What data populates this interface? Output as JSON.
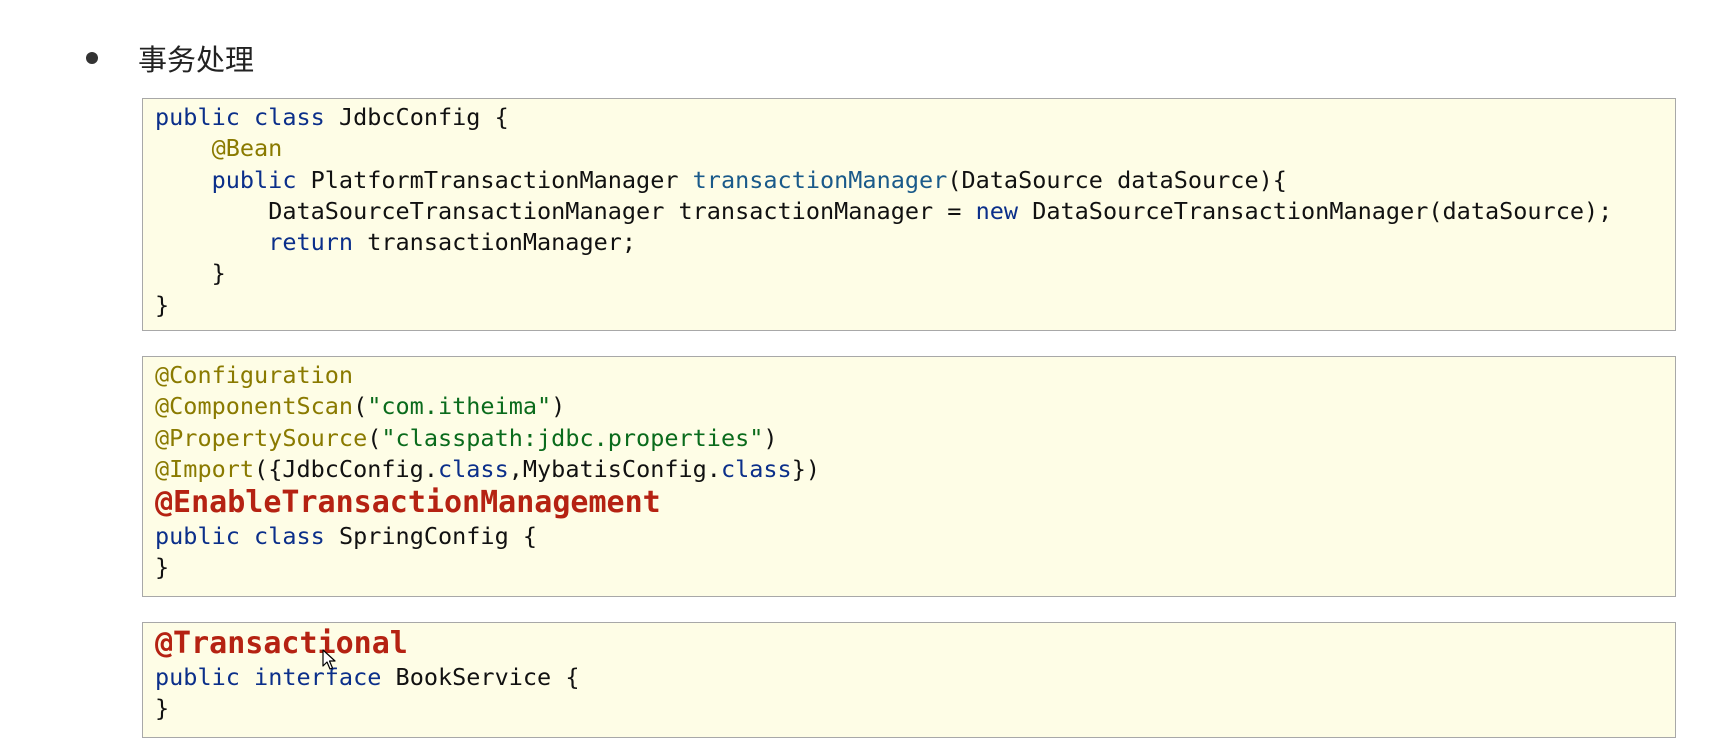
{
  "heading": {
    "text": "事务处理"
  },
  "box1": {
    "l1": {
      "kw1": "public",
      "kw2": "class",
      "rest": "JdbcConfig {"
    },
    "l2": {
      "ann": "@Bean"
    },
    "l3": {
      "kw": "public",
      "type": "PlatformTransactionManager",
      "fn": "transactionManager",
      "rest": "(DataSource dataSource){"
    },
    "l4": {
      "a": "DataSourceTransactionManager transactionManager = ",
      "kw": "new",
      "b": "DataSourceTransactionManager(dataSource);"
    },
    "l5": {
      "kw": "return",
      "rest": "transactionManager;"
    },
    "l6": {
      "text": "}"
    },
    "l7": {
      "text": "}"
    }
  },
  "box2": {
    "l1": {
      "ann": "@Configuration"
    },
    "l2": {
      "ann": "@ComponentScan",
      "p1": "(",
      "str": "\"com.itheima\"",
      "p2": ")"
    },
    "l3": {
      "ann": "@PropertySource",
      "p1": "(",
      "str": "\"classpath:jdbc.properties\"",
      "p2": ")"
    },
    "l4": {
      "ann": "@Import",
      "a": "({JdbcConfig.",
      "kw1": "class",
      "b": ",MybatisConfig.",
      "kw2": "class",
      "c": "})"
    },
    "l5": {
      "hl": "@EnableTransactionManagement"
    },
    "l6": {
      "kw1": "public",
      "kw2": "class",
      "rest": "SpringConfig {"
    },
    "l7": {
      "text": "}"
    }
  },
  "box3": {
    "l1": {
      "hl": "@Transactional"
    },
    "l2": {
      "kw1": "public",
      "kw2": "interface",
      "rest": "BookService {"
    },
    "l3": {
      "text": "}"
    }
  },
  "colors": {
    "code_bg": "#fefde6",
    "keyword": "#0b2f8a",
    "annotation": "#8a7a00",
    "string": "#0a6b1c",
    "highlight": "#b52212"
  },
  "icons": {
    "bullet": "bullet-dot-icon",
    "cursor": "mouse-pointer-icon"
  }
}
